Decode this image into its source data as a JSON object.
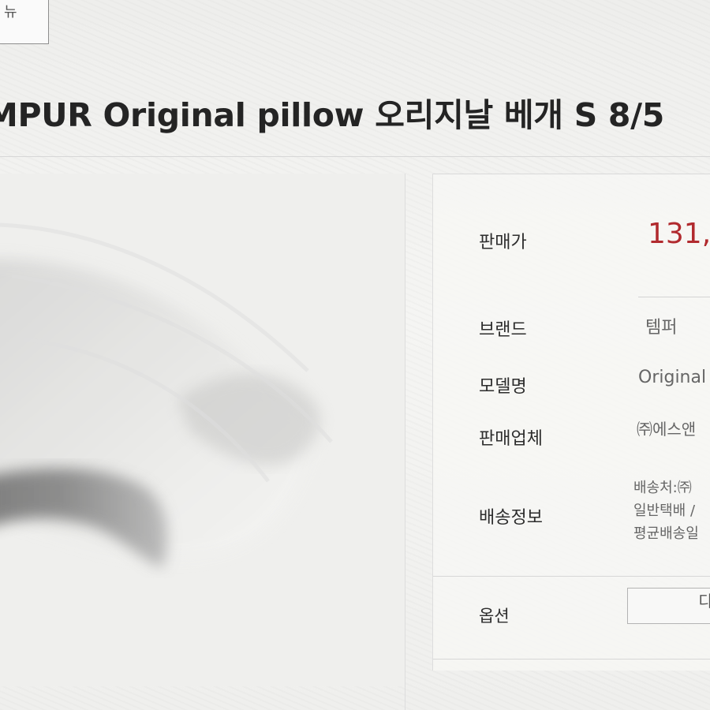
{
  "top_tab": {
    "label": "뉴"
  },
  "product": {
    "title": "MPUR Original pillow 오리지날 베개 S 8/5"
  },
  "price": {
    "label": "판매가",
    "value": "131,"
  },
  "details": {
    "brand": {
      "label": "브랜드",
      "value": "템퍼"
    },
    "model": {
      "label": "모델명",
      "value": "Original p"
    },
    "seller": {
      "label": "판매업체",
      "value": "㈜에스앤"
    },
    "shipping": {
      "label": "배송정보",
      "line_1": "배송처:㈜",
      "line_2": "일반택배 /",
      "line_3": "평균배송일"
    }
  },
  "option": {
    "label": "옵션",
    "selected_value": "다"
  },
  "icons": {
    "product_image": "pillow-image"
  },
  "colors": {
    "price": "#b12a2e",
    "border": "#d7d7d7"
  }
}
